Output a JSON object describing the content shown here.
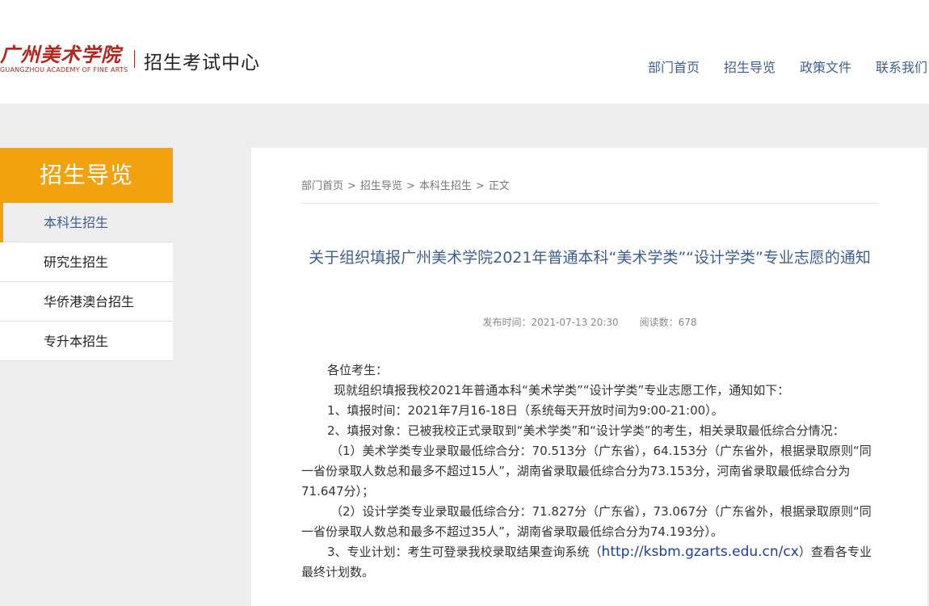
{
  "header": {
    "logo_cn": "广州美术学院",
    "logo_en": "GUANGZHOU ACADEMY OF FINE ARTS",
    "site_title": "招生考试中心",
    "nav": [
      "部门首页",
      "招生导览",
      "政策文件",
      "联系我们"
    ]
  },
  "sidebar": {
    "title": "招生导览",
    "items": [
      "本科生招生",
      "研究生招生",
      "华侨港澳台招生",
      "专升本招生"
    ],
    "active_index": 0
  },
  "breadcrumb": [
    "部门首页",
    "招生导览",
    "本科生招生",
    "正文"
  ],
  "breadcrumb_sep": ">",
  "article": {
    "title": "关于组织填报广州美术学院2021年普通本科“美术学类”“设计学类”专业志愿的通知",
    "publish_label": "发布时间：2021-07-13 20:30",
    "views_label": "阅读数：678",
    "paragraphs": {
      "p0": "各位考生：",
      "p1": "现就组织填报我校2021年普通本科“美术学类”“设计学类”专业志愿工作，通知如下：",
      "p2": "1、填报时间：2021年7月16-18日（系统每天开放时间为9:00-21:00）。",
      "p3": "2、填报对象：已被我校正式录取到“美术学类”和“设计学类”的考生，相关录取最低综合分情况：",
      "p4": "（1）美术学类专业录取最低综合分：70.513分（广东省），64.153分（广东省外，根据录取原则“同一省份录取人数总和最多不超过15人”，湖南省录取最低综合分为73.153分，河南省录取最低综合分为71.647分）；",
      "p5": "（2）设计学类专业录取最低综合分：71.827分（广东省），73.067分（广东省外，根据录取原则“同一省份录取人数总和最多不超过35人”，湖南省录取最低综合分为74.193分）。",
      "p6_pre": "3、专业计划：考生可登录我校录取结果查询系统（",
      "p6_link": "http://ksbm.gzarts.edu.cn/cx",
      "p6_post": "）查看各专业最终计划数。"
    }
  },
  "colors": {
    "accent": "#f2a20f",
    "link": "#3d5f8f",
    "logo_red": "#b3261e",
    "page_gray": "#eeeeee"
  }
}
